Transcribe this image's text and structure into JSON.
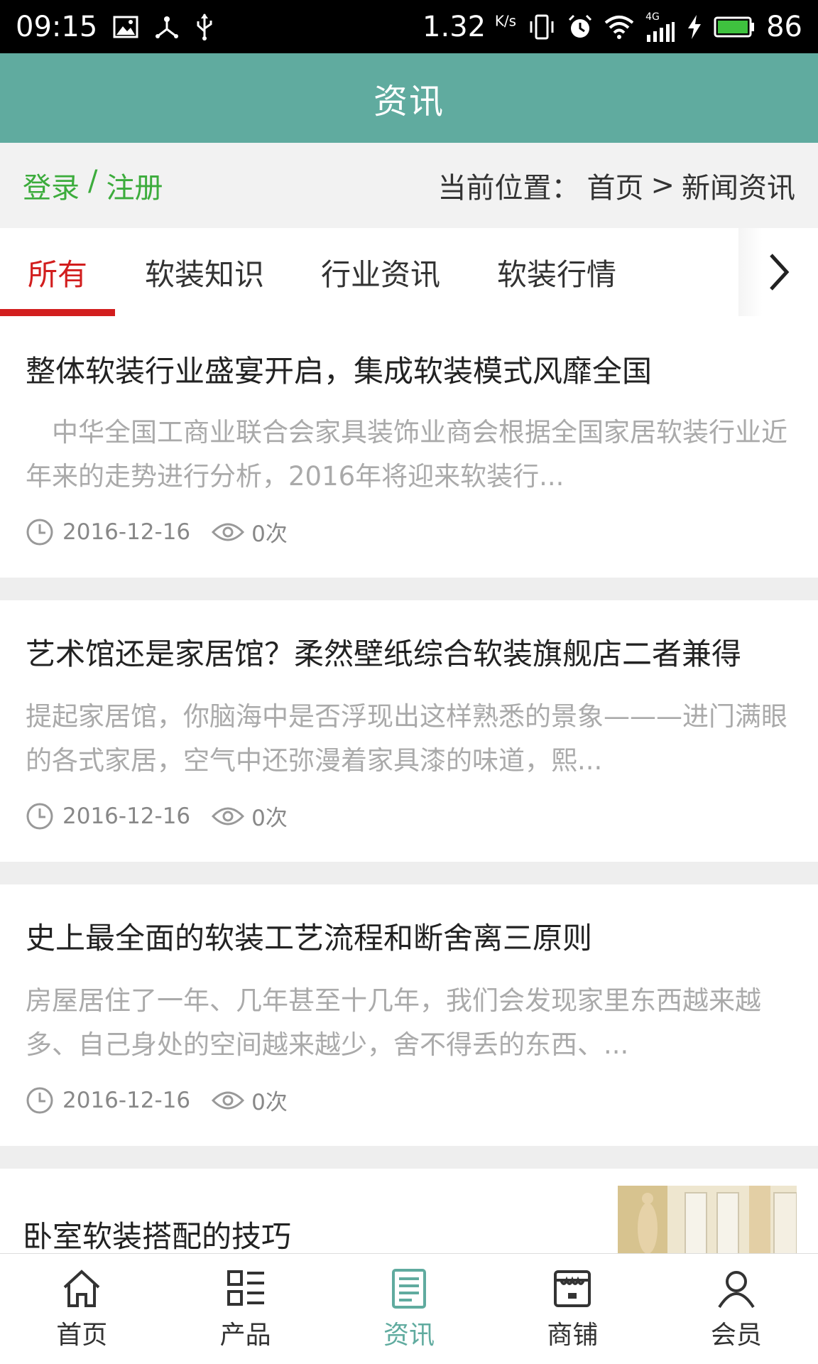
{
  "status_bar": {
    "time": "09:15",
    "net_speed": "1.32",
    "net_unit": "K/s",
    "network_type": "4G",
    "battery": "86",
    "icons_left": [
      "image-icon",
      "usb-tether-icon",
      "usb-icon"
    ],
    "icons_right": [
      "vibrate-icon",
      "alarm-icon",
      "wifi-icon",
      "signal-icon",
      "charging-icon",
      "battery-icon"
    ]
  },
  "header": {
    "title": "资讯"
  },
  "location_bar": {
    "login": "登录",
    "separator": "/",
    "register": "注册",
    "current_label": "当前位置：",
    "home": "首页",
    "arrow": ">",
    "current_page": "新闻资讯"
  },
  "tabs": [
    {
      "label": "所有",
      "active": true
    },
    {
      "label": "软装知识",
      "active": false
    },
    {
      "label": "行业资讯",
      "active": false
    },
    {
      "label": "软装行情",
      "active": false
    }
  ],
  "news": [
    {
      "title": "整体软装行业盛宴开启，集成软装模式风靡全国",
      "summary": "　中华全国工商业联合会家具装饰业商会根据全国家居软装行业近年来的走势进行分析，2016年将迎来软装行...",
      "date": "2016-12-16",
      "views": "0次"
    },
    {
      "title": "艺术馆还是家居馆？柔然壁纸综合软装旗舰店二者兼得",
      "summary": "提起家居馆，你脑海中是否浮现出这样熟悉的景象———进门满眼的各式家居，空气中还弥漫着家具漆的味道，熙...",
      "date": "2016-12-16",
      "views": "0次"
    },
    {
      "title": "史上最全面的软装工艺流程和断舍离三原则",
      "summary": "房屋居住了一年、几年甚至十几年，我们会发现家里东西越来越多、自己身处的空间越来越少，舍不得丢的东西、...",
      "date": "2016-12-16",
      "views": "0次"
    },
    {
      "title": "卧室软装搭配的技巧"
    }
  ],
  "bottom_nav": [
    {
      "label": "首页",
      "icon": "home-icon",
      "active": false
    },
    {
      "label": "产品",
      "icon": "grid-list-icon",
      "active": false
    },
    {
      "label": "资讯",
      "icon": "news-icon",
      "active": true
    },
    {
      "label": "商铺",
      "icon": "shop-icon",
      "active": false
    },
    {
      "label": "会员",
      "icon": "user-icon",
      "active": false
    }
  ],
  "colors": {
    "header_bg": "#60ab9f",
    "accent_green": "#3cac3c",
    "active_tab": "#d21e1e",
    "nav_active": "#60ab9f"
  }
}
